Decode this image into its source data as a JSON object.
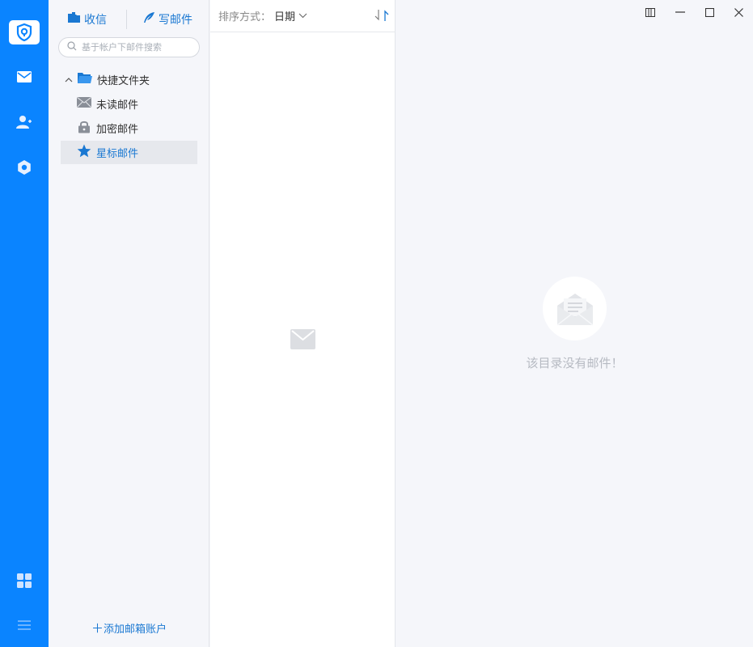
{
  "rail": {
    "icons": [
      "app-logo-icon",
      "mail-icon",
      "contacts-icon",
      "settings-icon",
      "apps-grid-icon",
      "menu-icon"
    ],
    "colors": {
      "background": "#0a84ff"
    }
  },
  "folders": {
    "receive_label": "收信",
    "compose_label": "写邮件",
    "search_placeholder": "基于帐户下邮件搜索",
    "tree": {
      "root_label": "快捷文件夹",
      "items": [
        {
          "label": "未读邮件",
          "icon": "envelope-icon"
        },
        {
          "label": "加密邮件",
          "icon": "lock-icon"
        },
        {
          "label": "星标邮件",
          "icon": "star-icon",
          "selected": true
        }
      ]
    },
    "add_account_label": "添加邮箱账户"
  },
  "maillist": {
    "sort_label": "排序方式：",
    "sort_value": "日期"
  },
  "detail": {
    "empty_text": "该目录没有邮件！"
  },
  "colors": {
    "accent": "#1a78d2",
    "selected_bg": "#e6e8ed"
  }
}
